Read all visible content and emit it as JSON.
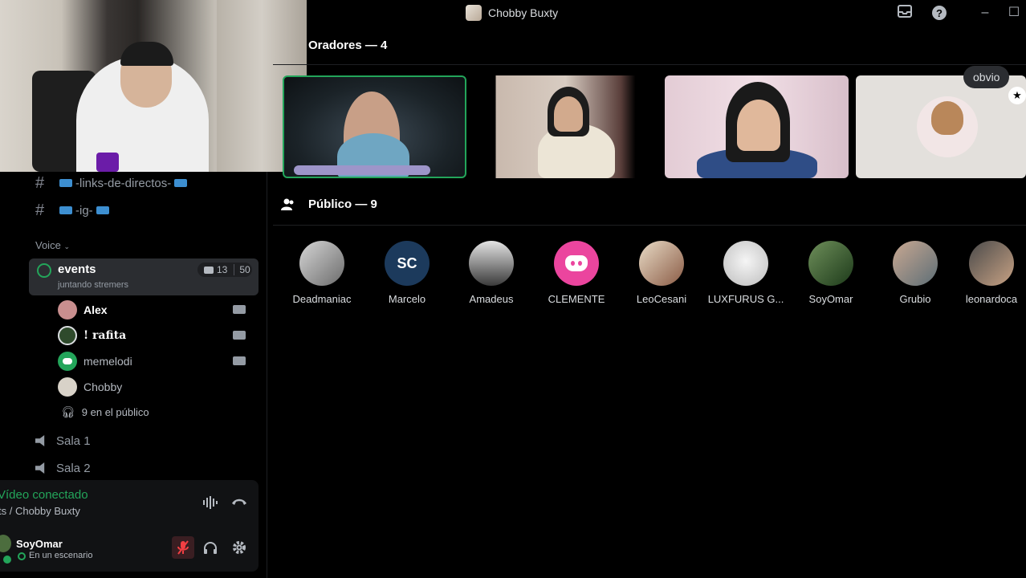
{
  "window": {
    "title": "Chobby Buxty",
    "controls": {
      "inbox_icon": "inbox-icon",
      "help_icon": "help-icon",
      "minimize": "–",
      "maximize": "☐"
    }
  },
  "sidebar": {
    "channels": [
      {
        "label": "-links-de-directos-",
        "icon": "hash-icon"
      },
      {
        "label": "-ig-",
        "icon": "hash-icon"
      }
    ],
    "voice_category": "Voice",
    "stage": {
      "name": "events",
      "topic": "juntando stremers",
      "video_count": "13",
      "limit": "50",
      "participants": [
        {
          "name": "Alex",
          "has_camera": true
        },
        {
          "name": "! rafita",
          "has_camera": true
        },
        {
          "name": "memelodi",
          "has_camera": true
        },
        {
          "name": "Chobby",
          "has_camera": false
        }
      ],
      "audience_summary": "9 en el público"
    },
    "voice_rooms": [
      "Sala 1",
      "Sala 2"
    ]
  },
  "connection": {
    "status": "Vídeo conectado",
    "location": "ts / Chobby Buxty"
  },
  "user": {
    "name": "SoyOmar",
    "status": "En un escenario"
  },
  "stage_view": {
    "speakers_title": "Oradores — 4",
    "audience_title": "Público — 9",
    "speaker_tooltip": "obvio",
    "audience": [
      {
        "name": "Deadmaniac"
      },
      {
        "name": "Marcelo"
      },
      {
        "name": "Amadeus"
      },
      {
        "name": "CLEMENTE"
      },
      {
        "name": "LeoCesani"
      },
      {
        "name": "LUXFURUS G..."
      },
      {
        "name": "SoyOmar"
      },
      {
        "name": "Grubio"
      },
      {
        "name": "leonardoca"
      }
    ]
  },
  "colors": {
    "accent_green": "#23a55a",
    "mute_red": "#f23f43",
    "discord_pink": "#eb459e"
  }
}
